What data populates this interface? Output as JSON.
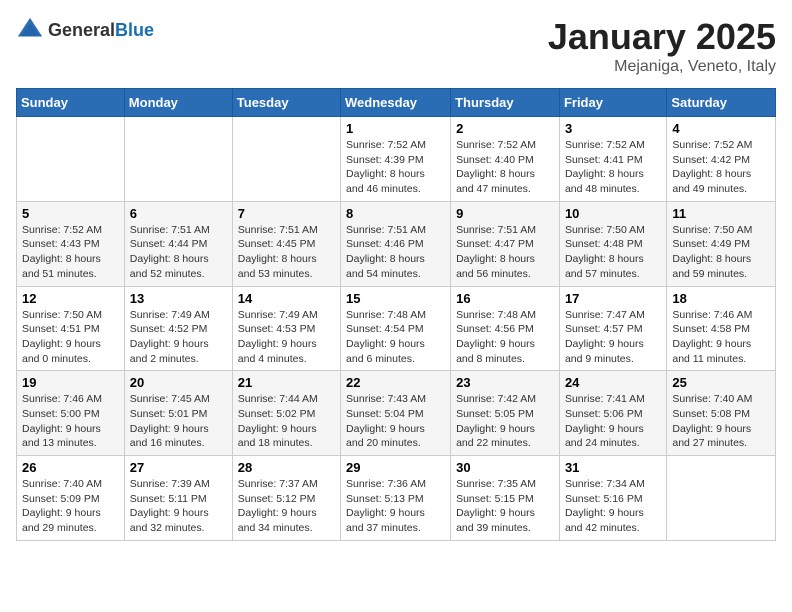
{
  "logo": {
    "text_general": "General",
    "text_blue": "Blue"
  },
  "header": {
    "month": "January 2025",
    "location": "Mejaniga, Veneto, Italy"
  },
  "weekdays": [
    "Sunday",
    "Monday",
    "Tuesday",
    "Wednesday",
    "Thursday",
    "Friday",
    "Saturday"
  ],
  "weeks": [
    [
      {
        "day": "",
        "sunrise": "",
        "sunset": "",
        "daylight": ""
      },
      {
        "day": "",
        "sunrise": "",
        "sunset": "",
        "daylight": ""
      },
      {
        "day": "",
        "sunrise": "",
        "sunset": "",
        "daylight": ""
      },
      {
        "day": "1",
        "sunrise": "Sunrise: 7:52 AM",
        "sunset": "Sunset: 4:39 PM",
        "daylight": "Daylight: 8 hours and 46 minutes."
      },
      {
        "day": "2",
        "sunrise": "Sunrise: 7:52 AM",
        "sunset": "Sunset: 4:40 PM",
        "daylight": "Daylight: 8 hours and 47 minutes."
      },
      {
        "day": "3",
        "sunrise": "Sunrise: 7:52 AM",
        "sunset": "Sunset: 4:41 PM",
        "daylight": "Daylight: 8 hours and 48 minutes."
      },
      {
        "day": "4",
        "sunrise": "Sunrise: 7:52 AM",
        "sunset": "Sunset: 4:42 PM",
        "daylight": "Daylight: 8 hours and 49 minutes."
      }
    ],
    [
      {
        "day": "5",
        "sunrise": "Sunrise: 7:52 AM",
        "sunset": "Sunset: 4:43 PM",
        "daylight": "Daylight: 8 hours and 51 minutes."
      },
      {
        "day": "6",
        "sunrise": "Sunrise: 7:51 AM",
        "sunset": "Sunset: 4:44 PM",
        "daylight": "Daylight: 8 hours and 52 minutes."
      },
      {
        "day": "7",
        "sunrise": "Sunrise: 7:51 AM",
        "sunset": "Sunset: 4:45 PM",
        "daylight": "Daylight: 8 hours and 53 minutes."
      },
      {
        "day": "8",
        "sunrise": "Sunrise: 7:51 AM",
        "sunset": "Sunset: 4:46 PM",
        "daylight": "Daylight: 8 hours and 54 minutes."
      },
      {
        "day": "9",
        "sunrise": "Sunrise: 7:51 AM",
        "sunset": "Sunset: 4:47 PM",
        "daylight": "Daylight: 8 hours and 56 minutes."
      },
      {
        "day": "10",
        "sunrise": "Sunrise: 7:50 AM",
        "sunset": "Sunset: 4:48 PM",
        "daylight": "Daylight: 8 hours and 57 minutes."
      },
      {
        "day": "11",
        "sunrise": "Sunrise: 7:50 AM",
        "sunset": "Sunset: 4:49 PM",
        "daylight": "Daylight: 8 hours and 59 minutes."
      }
    ],
    [
      {
        "day": "12",
        "sunrise": "Sunrise: 7:50 AM",
        "sunset": "Sunset: 4:51 PM",
        "daylight": "Daylight: 9 hours and 0 minutes."
      },
      {
        "day": "13",
        "sunrise": "Sunrise: 7:49 AM",
        "sunset": "Sunset: 4:52 PM",
        "daylight": "Daylight: 9 hours and 2 minutes."
      },
      {
        "day": "14",
        "sunrise": "Sunrise: 7:49 AM",
        "sunset": "Sunset: 4:53 PM",
        "daylight": "Daylight: 9 hours and 4 minutes."
      },
      {
        "day": "15",
        "sunrise": "Sunrise: 7:48 AM",
        "sunset": "Sunset: 4:54 PM",
        "daylight": "Daylight: 9 hours and 6 minutes."
      },
      {
        "day": "16",
        "sunrise": "Sunrise: 7:48 AM",
        "sunset": "Sunset: 4:56 PM",
        "daylight": "Daylight: 9 hours and 8 minutes."
      },
      {
        "day": "17",
        "sunrise": "Sunrise: 7:47 AM",
        "sunset": "Sunset: 4:57 PM",
        "daylight": "Daylight: 9 hours and 9 minutes."
      },
      {
        "day": "18",
        "sunrise": "Sunrise: 7:46 AM",
        "sunset": "Sunset: 4:58 PM",
        "daylight": "Daylight: 9 hours and 11 minutes."
      }
    ],
    [
      {
        "day": "19",
        "sunrise": "Sunrise: 7:46 AM",
        "sunset": "Sunset: 5:00 PM",
        "daylight": "Daylight: 9 hours and 13 minutes."
      },
      {
        "day": "20",
        "sunrise": "Sunrise: 7:45 AM",
        "sunset": "Sunset: 5:01 PM",
        "daylight": "Daylight: 9 hours and 16 minutes."
      },
      {
        "day": "21",
        "sunrise": "Sunrise: 7:44 AM",
        "sunset": "Sunset: 5:02 PM",
        "daylight": "Daylight: 9 hours and 18 minutes."
      },
      {
        "day": "22",
        "sunrise": "Sunrise: 7:43 AM",
        "sunset": "Sunset: 5:04 PM",
        "daylight": "Daylight: 9 hours and 20 minutes."
      },
      {
        "day": "23",
        "sunrise": "Sunrise: 7:42 AM",
        "sunset": "Sunset: 5:05 PM",
        "daylight": "Daylight: 9 hours and 22 minutes."
      },
      {
        "day": "24",
        "sunrise": "Sunrise: 7:41 AM",
        "sunset": "Sunset: 5:06 PM",
        "daylight": "Daylight: 9 hours and 24 minutes."
      },
      {
        "day": "25",
        "sunrise": "Sunrise: 7:40 AM",
        "sunset": "Sunset: 5:08 PM",
        "daylight": "Daylight: 9 hours and 27 minutes."
      }
    ],
    [
      {
        "day": "26",
        "sunrise": "Sunrise: 7:40 AM",
        "sunset": "Sunset: 5:09 PM",
        "daylight": "Daylight: 9 hours and 29 minutes."
      },
      {
        "day": "27",
        "sunrise": "Sunrise: 7:39 AM",
        "sunset": "Sunset: 5:11 PM",
        "daylight": "Daylight: 9 hours and 32 minutes."
      },
      {
        "day": "28",
        "sunrise": "Sunrise: 7:37 AM",
        "sunset": "Sunset: 5:12 PM",
        "daylight": "Daylight: 9 hours and 34 minutes."
      },
      {
        "day": "29",
        "sunrise": "Sunrise: 7:36 AM",
        "sunset": "Sunset: 5:13 PM",
        "daylight": "Daylight: 9 hours and 37 minutes."
      },
      {
        "day": "30",
        "sunrise": "Sunrise: 7:35 AM",
        "sunset": "Sunset: 5:15 PM",
        "daylight": "Daylight: 9 hours and 39 minutes."
      },
      {
        "day": "31",
        "sunrise": "Sunrise: 7:34 AM",
        "sunset": "Sunset: 5:16 PM",
        "daylight": "Daylight: 9 hours and 42 minutes."
      },
      {
        "day": "",
        "sunrise": "",
        "sunset": "",
        "daylight": ""
      }
    ]
  ]
}
